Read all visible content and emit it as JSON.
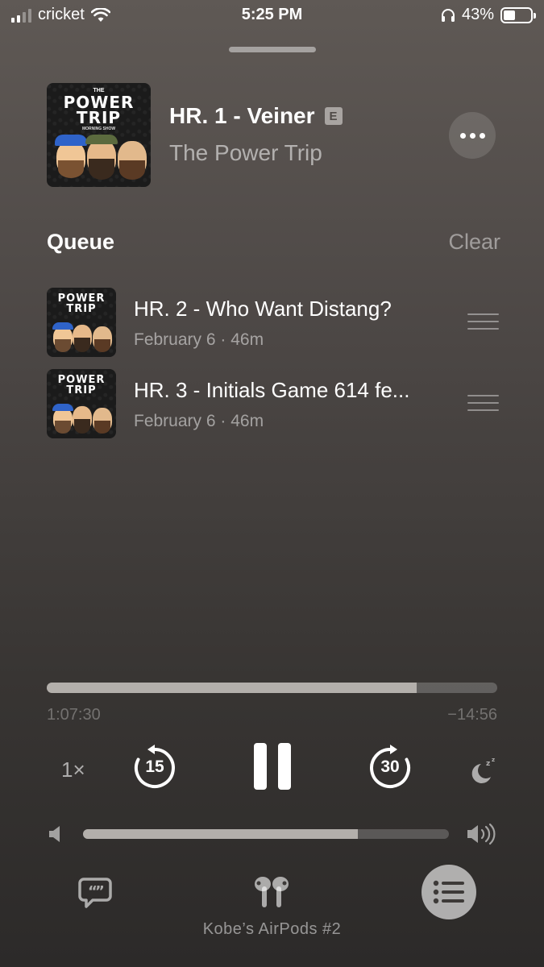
{
  "status_bar": {
    "carrier": "cricket",
    "time": "5:25 PM",
    "battery_percent": "43%",
    "battery_level": 0.43,
    "icons": [
      "signal-icon",
      "wifi-icon",
      "headphones-icon",
      "battery-icon"
    ]
  },
  "now_playing": {
    "title": "HR. 1 - Veiner",
    "explicit_badge": "E",
    "show": "The Power Trip",
    "artwork": {
      "line1": "THE",
      "line2": "POWER",
      "line3": "TRIP",
      "line4": "MORNING SHOW"
    }
  },
  "queue": {
    "heading": "Queue",
    "clear_label": "Clear",
    "items": [
      {
        "title": "HR. 2 - Who Want Distang?",
        "meta": "February 6 · 46m"
      },
      {
        "title": "HR. 3 - Initials Game 614 fe...",
        "meta": "February 6 · 46m"
      }
    ]
  },
  "playback": {
    "elapsed": "1:07:30",
    "remaining": "−14:56",
    "progress_fraction": 0.822,
    "speed_label": "1×",
    "skip_back_seconds": "15",
    "skip_forward_seconds": "30",
    "volume_fraction": 0.75
  },
  "route": {
    "device_name": "Kobe’s AirPods #2"
  },
  "colors": {
    "background_top": "#5f5955",
    "background_bottom": "#2c2a29",
    "scrubber_fill": "#b3afab"
  }
}
